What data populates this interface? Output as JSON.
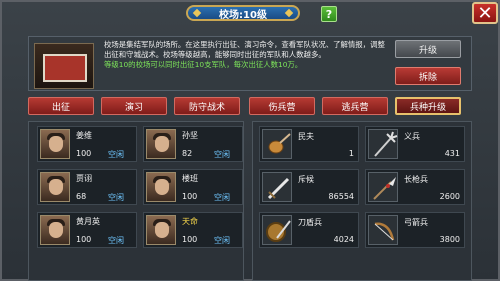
{
  "title": "校场:10级",
  "help_label": "?",
  "close_label": "✕",
  "info": {
    "description": "校场是集结军队的场所。在这里执行出征、演习命令，查看军队状况、了解情报，调整出征和守城战术。校场等级越高，能够同时出征的军队和人数越多。",
    "level_note": "等级10的校场可以同时出征10支军队，每次出征人数10万。"
  },
  "buttons": {
    "upgrade": "升级",
    "demolish": "拆除"
  },
  "tabs": [
    "出征",
    "演习",
    "防守战术",
    "伤兵营",
    "逃兵营",
    "兵种升级"
  ],
  "generals": [
    {
      "name": "姜维",
      "num": "100",
      "status": "空闲",
      "highlight": false
    },
    {
      "name": "孙坚",
      "num": "82",
      "status": "空闲",
      "highlight": false
    },
    {
      "name": "贾诩",
      "num": "68",
      "status": "空闲",
      "highlight": false
    },
    {
      "name": "楼班",
      "num": "100",
      "status": "空闲",
      "highlight": false
    },
    {
      "name": "黄月英",
      "num": "100",
      "status": "空闲",
      "highlight": false
    },
    {
      "name": "天命",
      "num": "100",
      "status": "空闲",
      "highlight": true
    }
  ],
  "units": [
    {
      "name": "民夫",
      "count": "1",
      "icon": "pipa-icon"
    },
    {
      "name": "义兵",
      "count": "431",
      "icon": "trident-icon"
    },
    {
      "name": "斥候",
      "count": "86554",
      "icon": "sword-icon"
    },
    {
      "name": "长枪兵",
      "count": "2600",
      "icon": "spear-icon"
    },
    {
      "name": "刀盾兵",
      "count": "4024",
      "icon": "shield-icon"
    },
    {
      "name": "弓箭兵",
      "count": "3800",
      "icon": "bow-icon"
    }
  ]
}
